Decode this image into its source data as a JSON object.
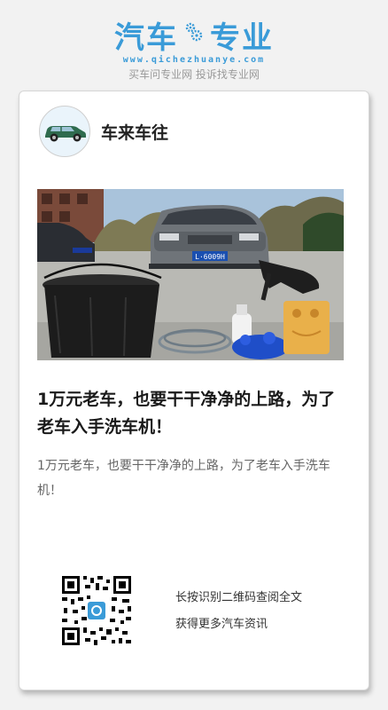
{
  "brand": {
    "logo_left": "汽车",
    "logo_right": "专业",
    "url": "www.qichezhuanye.com",
    "slogan": "买车问专业网 投诉找专业网",
    "accent_color": "#3a9bd8"
  },
  "author": {
    "name": "车来车往",
    "avatar_icon": "green-car-avatar-icon"
  },
  "hero_image": {
    "plate_text": "L·6009H"
  },
  "article": {
    "title": "1万元老车，也要干干净净的上路，为了老车入手洗车机！",
    "summary": "1万元老车，也要干干净净的上路，为了老车入手洗车机！"
  },
  "qr": {
    "icon": "qr-code-icon",
    "line1": "长按识别二维码查阅全文",
    "line2": "获得更多汽车资讯"
  }
}
